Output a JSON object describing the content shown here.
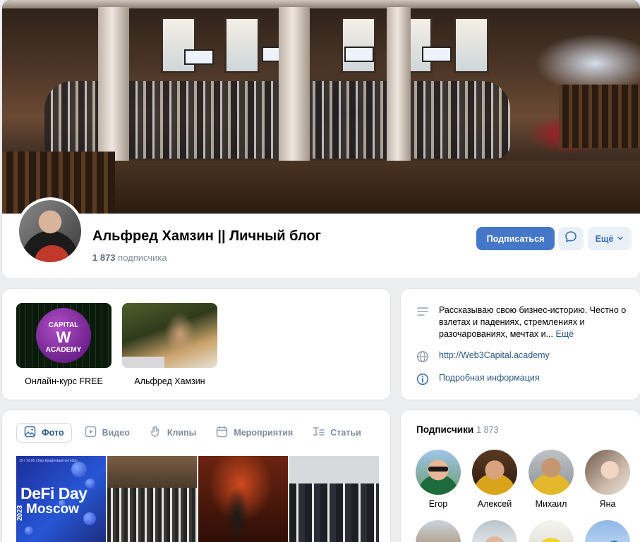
{
  "profile": {
    "name": "Альфред Хамзин || Личный блог",
    "subscribers_count": "1 873",
    "subscribers_word": "подписчика",
    "subscribe_label": "Подписаться",
    "more_label": "Ещё"
  },
  "links": [
    {
      "label": "Онлайн-курс FREE",
      "logo_top": "CAPITAL",
      "logo_mid": "W",
      "logo_bottom": "ACADEMY"
    },
    {
      "label": "Альфред Хамзин"
    }
  ],
  "about": {
    "description": "Рассказываю свою бизнес-историю. Честно о взлетах и падениях, стремлениях и разочарованиях, мечтах и...",
    "more": "Ещё",
    "website": "http://Web3Capital.academy",
    "details": "Подробная информация"
  },
  "media": {
    "tabs": [
      {
        "label": "Фото",
        "active": true
      },
      {
        "label": "Видео"
      },
      {
        "label": "Клипы"
      },
      {
        "label": "Мероприятия"
      },
      {
        "label": "Статьи"
      }
    ],
    "photo1": {
      "top_text": "19 / 10.00 | Бар Крафтовый октябрь",
      "title1": "DeFi Day",
      "title2": "Moscow",
      "year": "2023"
    }
  },
  "subscribers": {
    "title": "Подписчики",
    "count": "1 873",
    "people": [
      {
        "name": "Егор"
      },
      {
        "name": "Алексей"
      },
      {
        "name": "Михаил"
      },
      {
        "name": "Яна"
      }
    ]
  },
  "colors": {
    "accent": "#4477c8",
    "link": "#2a5885",
    "muted": "#818c99",
    "background": "#edeef0"
  }
}
